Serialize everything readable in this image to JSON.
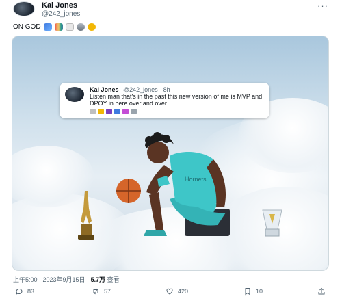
{
  "author": {
    "name": "Kai Jones",
    "handle": "@242_jones"
  },
  "tweet": {
    "text": "ON GOD",
    "emojis": [
      "butterfly",
      "rainbow",
      "goat",
      "ufo",
      "medal"
    ]
  },
  "quoted_tweet": {
    "name": "Kai Jones",
    "handle_time": "@242_jones · 8h",
    "text": "Listen man that's in the past this new version of me is MVP and DPOY in here over and over",
    "emojis": [
      "goat",
      "flexed-biceps",
      "peace",
      "butterfly",
      "heart",
      "rocket"
    ]
  },
  "meta": {
    "time_date": "上午5:00 · 2023年9月15日 · ",
    "views": "5.7万",
    "views_label": " 查看"
  },
  "actions": {
    "reply_count": "83",
    "retweet_count": "57",
    "like_count": "420",
    "bookmark_count": "10"
  },
  "colors": {
    "text": "#0f1419",
    "secondary": "#536471",
    "jersey": "#3ec6c8",
    "sky": "#a9c7dd"
  }
}
